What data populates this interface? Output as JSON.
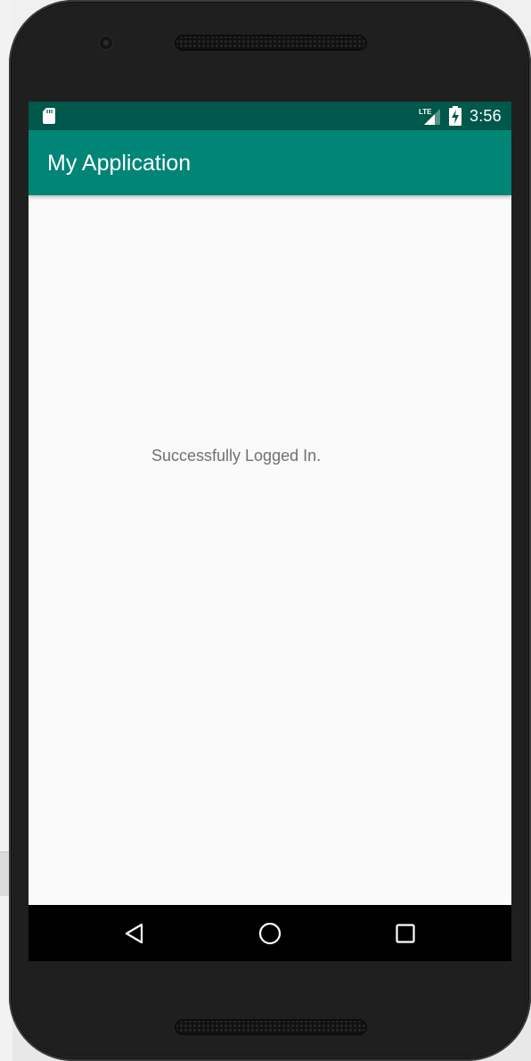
{
  "status_bar": {
    "time": "3:56",
    "network_label": "LTE",
    "icons": [
      "sd-card-icon",
      "lte-signal-icon",
      "battery-charging-icon"
    ]
  },
  "app_bar": {
    "title": "My Application"
  },
  "content": {
    "message": "Successfully Logged In."
  },
  "nav_bar": {
    "buttons": [
      "back-icon",
      "home-icon",
      "recents-icon"
    ]
  },
  "colors": {
    "status_bar": "#00574b",
    "app_bar": "#008577",
    "background": "#fafafa",
    "message_text": "#707070"
  }
}
